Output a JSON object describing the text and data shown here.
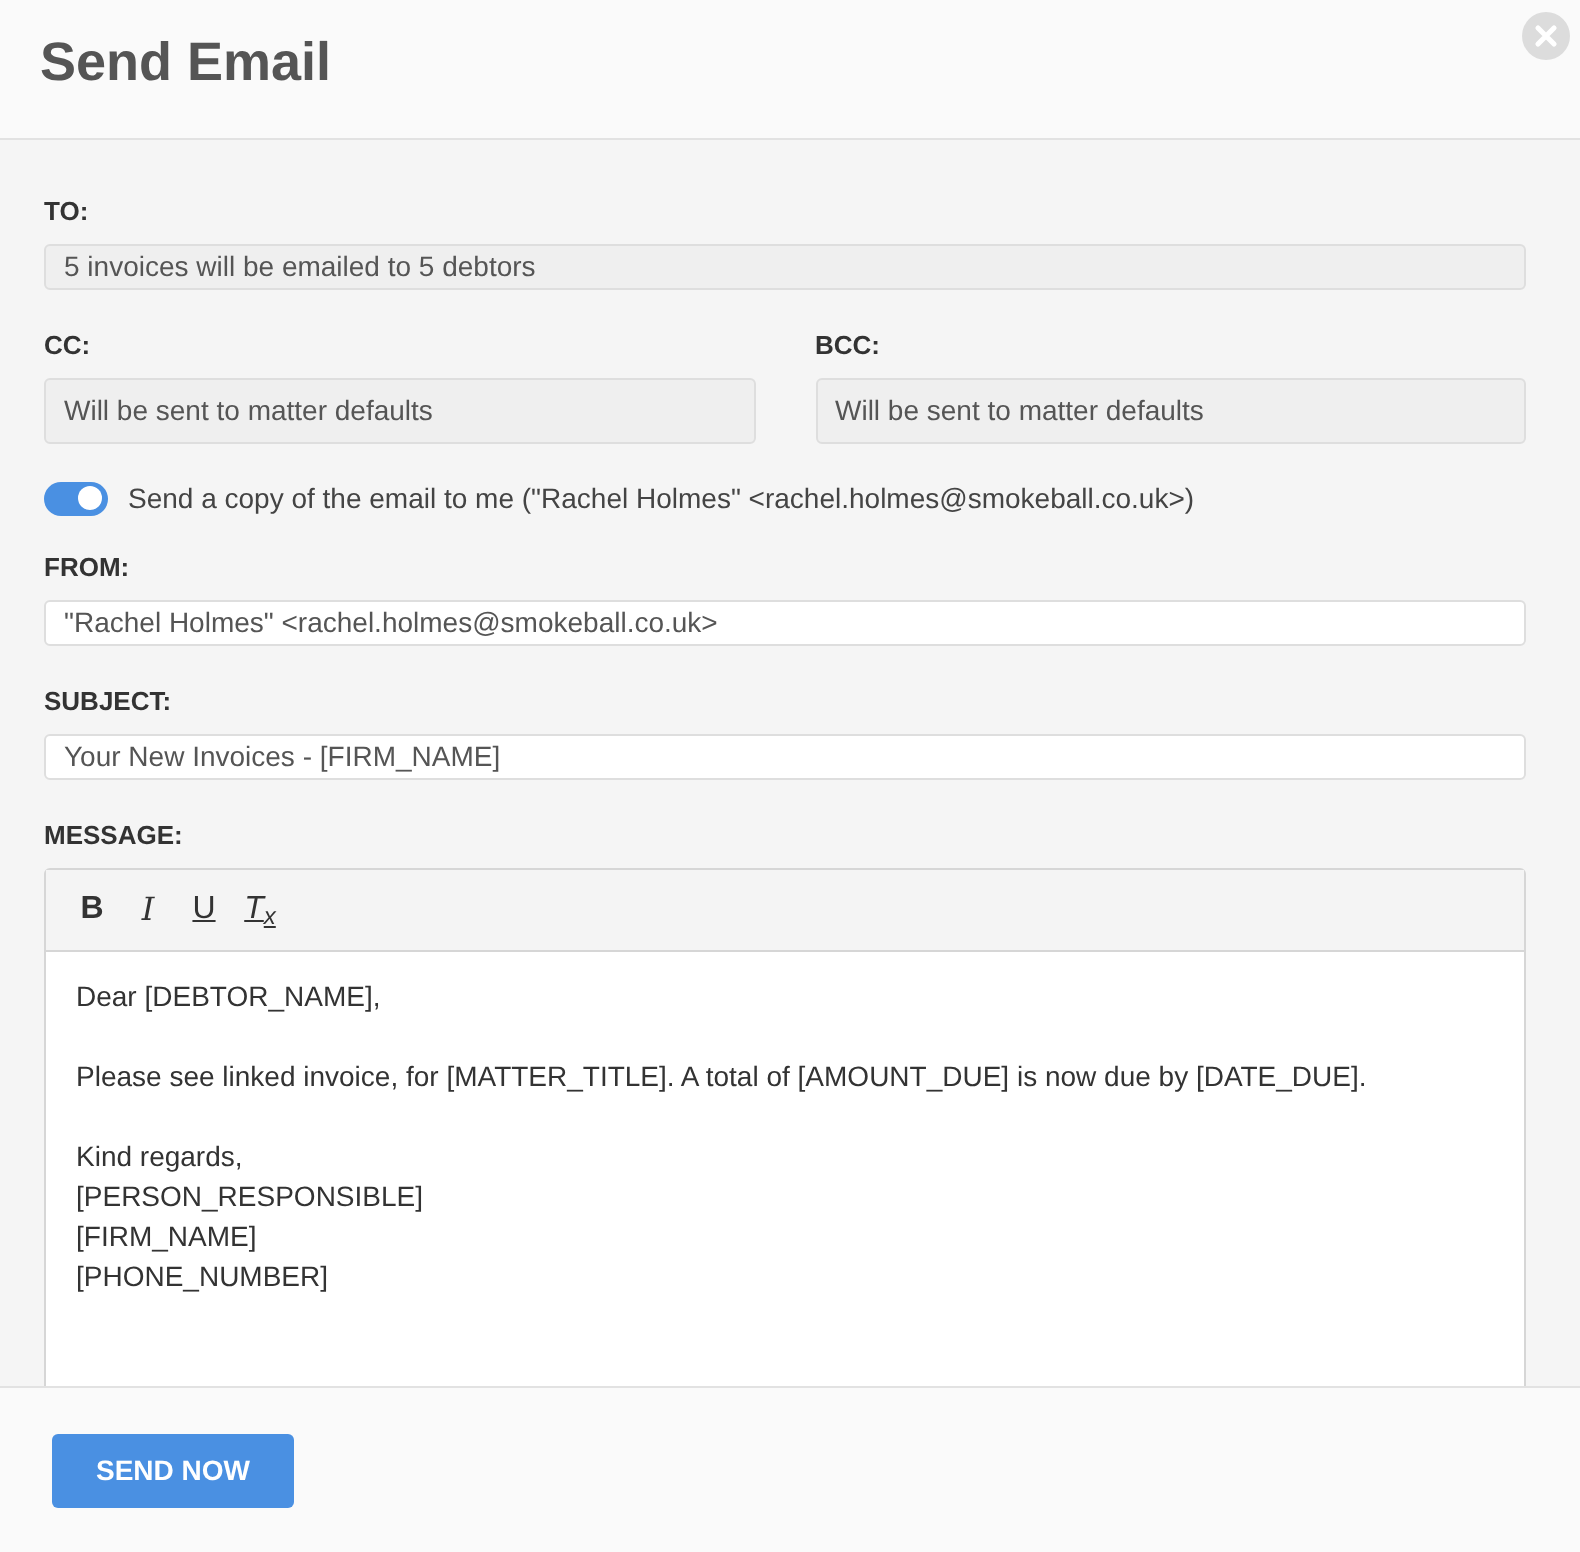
{
  "window": {
    "title": "Send Email"
  },
  "to": {
    "label": "TO:",
    "value": "5 invoices will be emailed to 5 debtors"
  },
  "cc": {
    "label": "CC:",
    "value": "Will be sent to matter defaults"
  },
  "bcc": {
    "label": "BCC:",
    "value": "Will be sent to matter defaults"
  },
  "copy_toggle": {
    "on": true,
    "label": "Send a copy of the email to me (\"Rachel Holmes\" <rachel.holmes@smokeball.co.uk>)"
  },
  "from": {
    "label": "FROM:",
    "value": "\"Rachel Holmes\" <rachel.holmes@smokeball.co.uk>"
  },
  "subject": {
    "label": "SUBJECT:",
    "value": "Your New Invoices - [FIRM_NAME]"
  },
  "message": {
    "label": "MESSAGE:",
    "toolbar": [
      {
        "kind": "bold",
        "label": "B"
      },
      {
        "kind": "italic",
        "label": "I"
      },
      {
        "kind": "underline",
        "label": "U"
      },
      {
        "kind": "clear",
        "label": "*T*$_{x}$"
      }
    ],
    "paragraphs": [
      [
        "Dear [DEBTOR_NAME],"
      ],
      [
        "Please see linked invoice, for [MATTER_TITLE]. A total of [AMOUNT_DUE] is now due by [DATE_DUE]."
      ],
      [
        "Kind regards,",
        "[PERSON_RESPONSIBLE]",
        "[FIRM_NAME]",
        "[PHONE_NUMBER]"
      ]
    ]
  },
  "buttons": [
    {
      "label": "SEND NOW"
    }
  ]
}
